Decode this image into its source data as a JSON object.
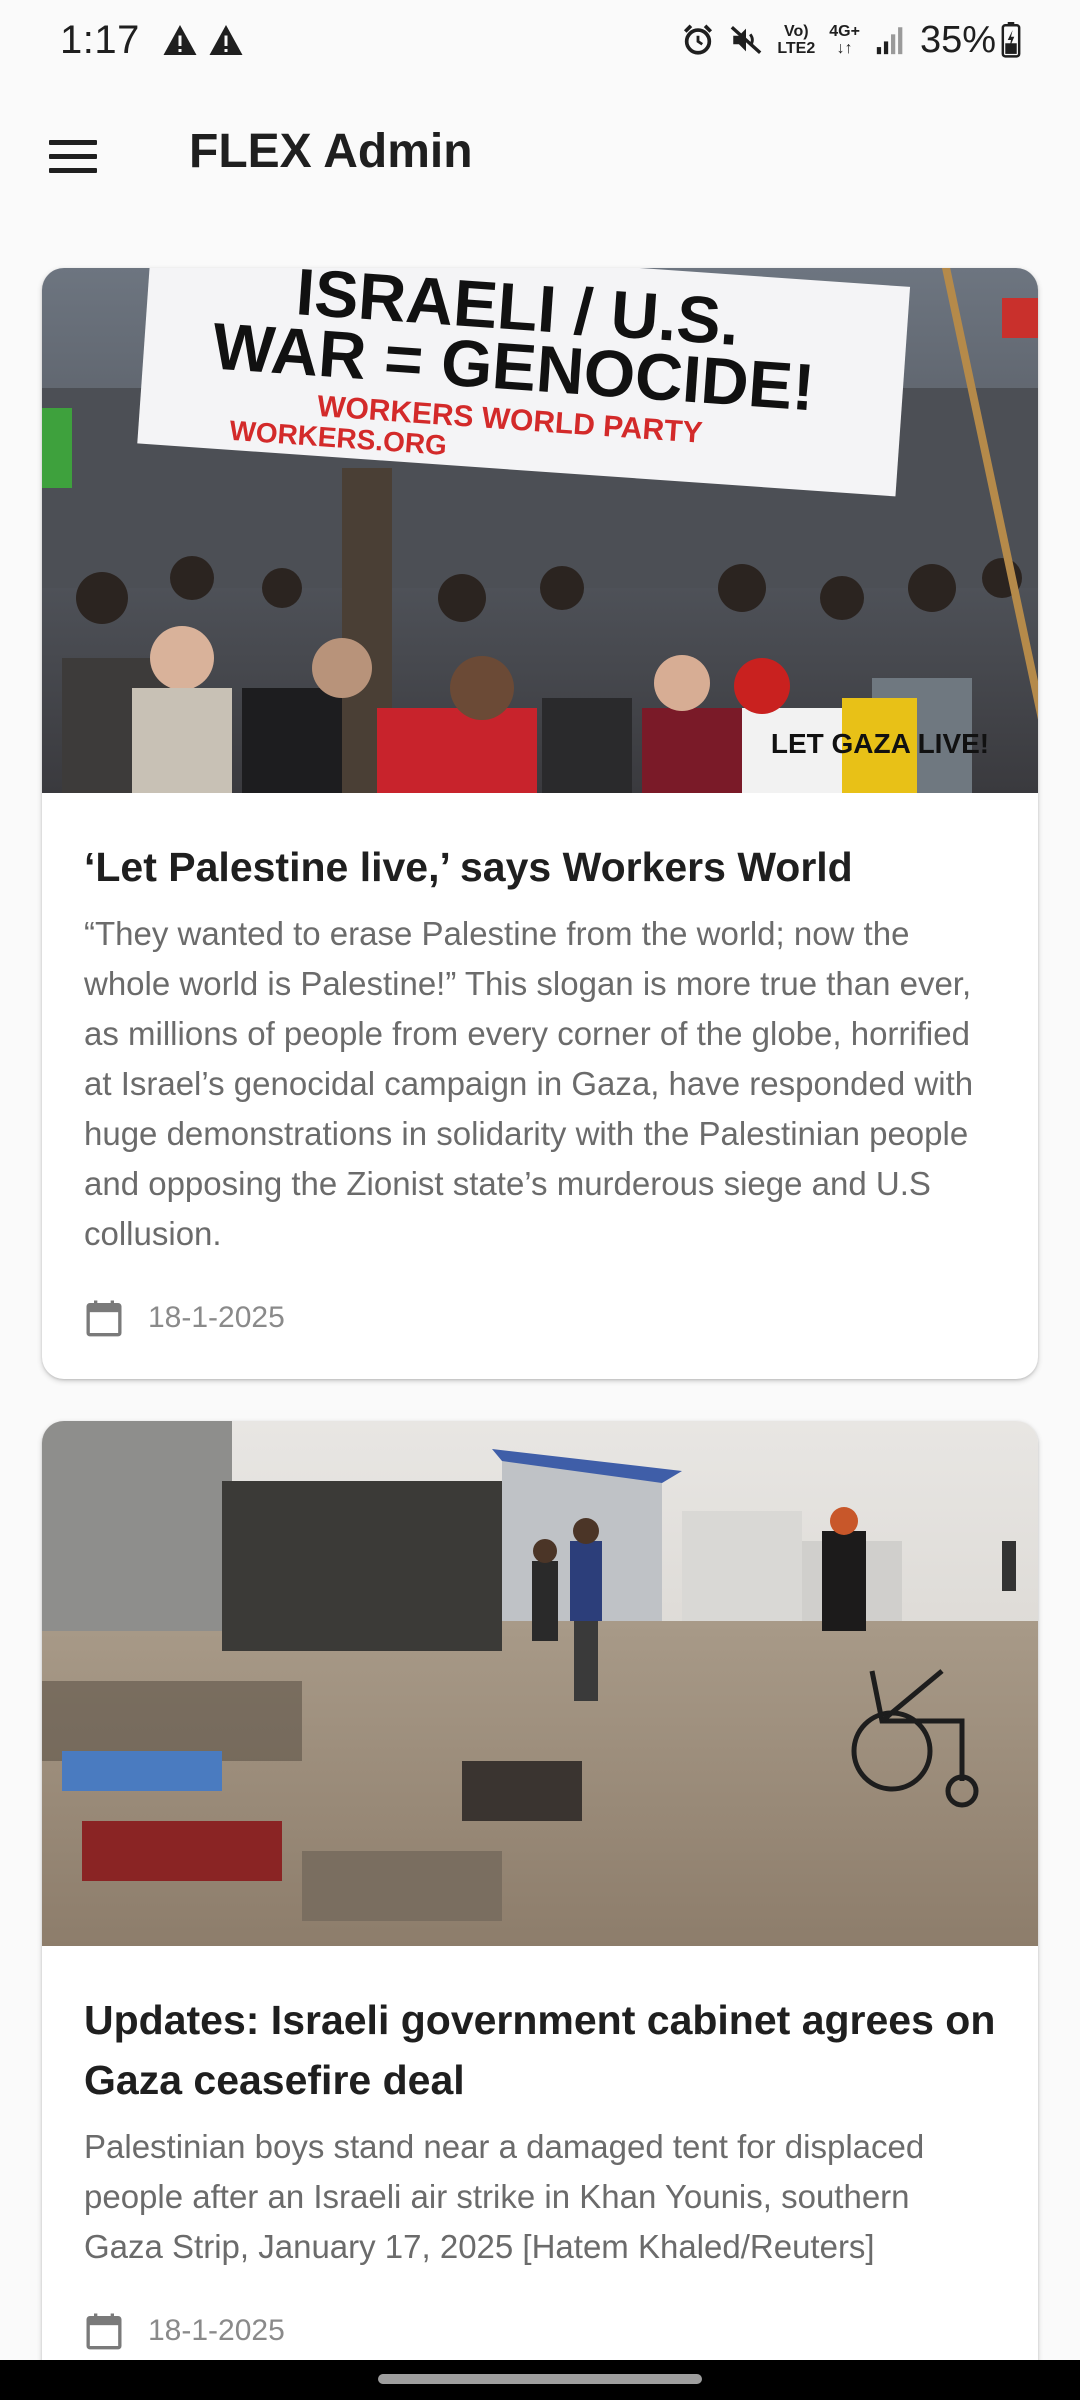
{
  "status_bar": {
    "time": "1:17",
    "left_icons": [
      "warning-icon",
      "warning-icon"
    ],
    "right_icons": [
      "alarm-icon",
      "mute-icon",
      "volte-icon",
      "4g-icon",
      "signal-icon"
    ],
    "volte_label_top": "Vo)",
    "volte_label_bottom": "LTE2",
    "network_label": "4G+",
    "battery": "35%"
  },
  "app_bar": {
    "title": "FLEX Admin",
    "menu_icon": "hamburger-menu-icon"
  },
  "articles": [
    {
      "image_sign_line1": "ISRAELI / U.S.",
      "image_sign_line2": "WAR = GENOCIDE!",
      "image_sign_line3": "WORKERS WORLD PARTY",
      "image_sign_line4": "WORKERS.ORG",
      "image_sign_line5": "LET GAZA LIVE!",
      "title": "‘Let Palestine live,’ says Workers World",
      "description": "“They wanted to erase Palestine from the world; now the whole world is Palestine!” This slogan is more true than ever, as millions of people from every corner of the globe, horrified at Israel’s genocidal campaign in Gaza, have responded with huge demonstrations in solidarity with the Palestinian people and opposing the Zionist state’s murderous siege and U.S collusion.",
      "date": "18-1-2025"
    },
    {
      "title": "Updates: Israeli government cabinet agrees on Gaza ceasefire deal",
      "description": "Palestinian boys stand near a damaged tent for displaced people after an Israeli air strike in Khan Younis, southern Gaza Strip, January 17, 2025 [Hatem Khaled/Reuters]",
      "date": "18-1-2025"
    }
  ],
  "colors": {
    "background": "#fafafa",
    "card": "#ffffff",
    "title_text": "#1f1f1f",
    "body_text": "#6b6b6b",
    "date_text": "#8a8a8a"
  }
}
